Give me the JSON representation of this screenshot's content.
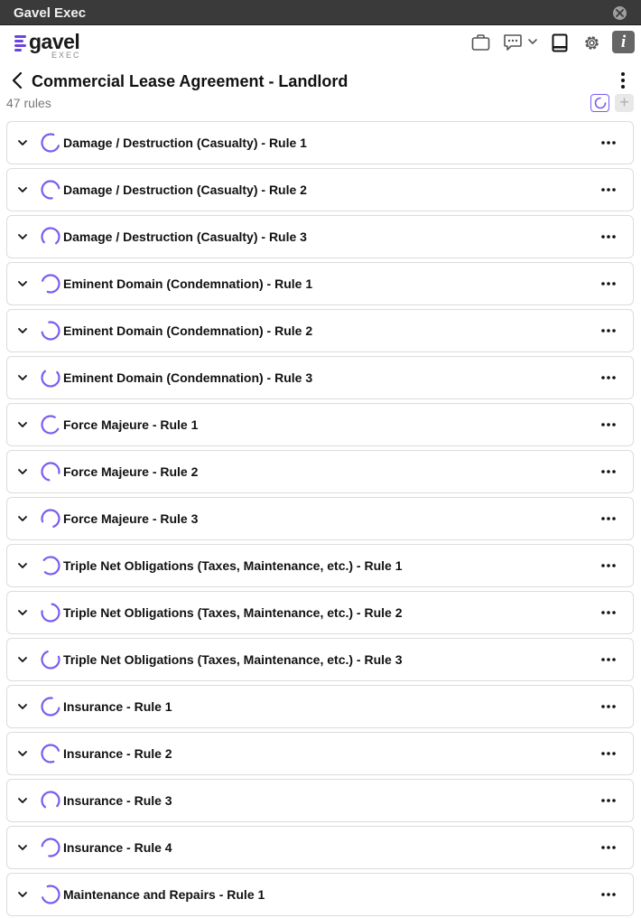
{
  "app": {
    "window_title": "Gavel Exec"
  },
  "logo": {
    "word": "gavel",
    "sub": "EXEC"
  },
  "colors": {
    "accent": "#7b5cf0",
    "brand": "#6b45e0"
  },
  "header_icons": [
    "briefcase-icon",
    "chat-icon",
    "chevron-down-icon",
    "book-icon",
    "gear-icon",
    "info-icon"
  ],
  "info_glyph": "i",
  "page": {
    "title": "Commercial Lease Agreement - Landlord",
    "rule_count": "47 rules",
    "add_glyph": "+"
  },
  "rules": [
    {
      "label": "Damage / Destruction (Casualty) - Rule 1",
      "spin_rotation": 20
    },
    {
      "label": "Damage / Destruction (Casualty) - Rule 2",
      "spin_rotation": 80
    },
    {
      "label": "Damage / Destruction (Casualty) - Rule 3",
      "spin_rotation": 140
    },
    {
      "label": "Eminent Domain (Condemnation) - Rule 1",
      "spin_rotation": 200
    },
    {
      "label": "Eminent Domain (Condemnation) - Rule 2",
      "spin_rotation": 260
    },
    {
      "label": "Eminent Domain (Condemnation) - Rule 3",
      "spin_rotation": 320
    },
    {
      "label": "Force Majeure - Rule 1",
      "spin_rotation": 30
    },
    {
      "label": "Force Majeure - Rule 2",
      "spin_rotation": 100
    },
    {
      "label": "Force Majeure - Rule 3",
      "spin_rotation": 160
    },
    {
      "label": "Triple Net Obligations (Taxes, Maintenance, etc.) - Rule 1",
      "spin_rotation": 220
    },
    {
      "label": "Triple Net Obligations (Taxes, Maintenance, etc.) - Rule 2",
      "spin_rotation": 280
    },
    {
      "label": "Triple Net Obligations (Taxes, Maintenance, etc.) - Rule 3",
      "spin_rotation": 340
    },
    {
      "label": "Insurance - Rule 1",
      "spin_rotation": 10
    },
    {
      "label": "Insurance - Rule 2",
      "spin_rotation": 70
    },
    {
      "label": "Insurance - Rule 3",
      "spin_rotation": 130
    },
    {
      "label": "Insurance - Rule 4",
      "spin_rotation": 190
    },
    {
      "label": "Maintenance and Repairs - Rule 1",
      "spin_rotation": 250
    }
  ]
}
